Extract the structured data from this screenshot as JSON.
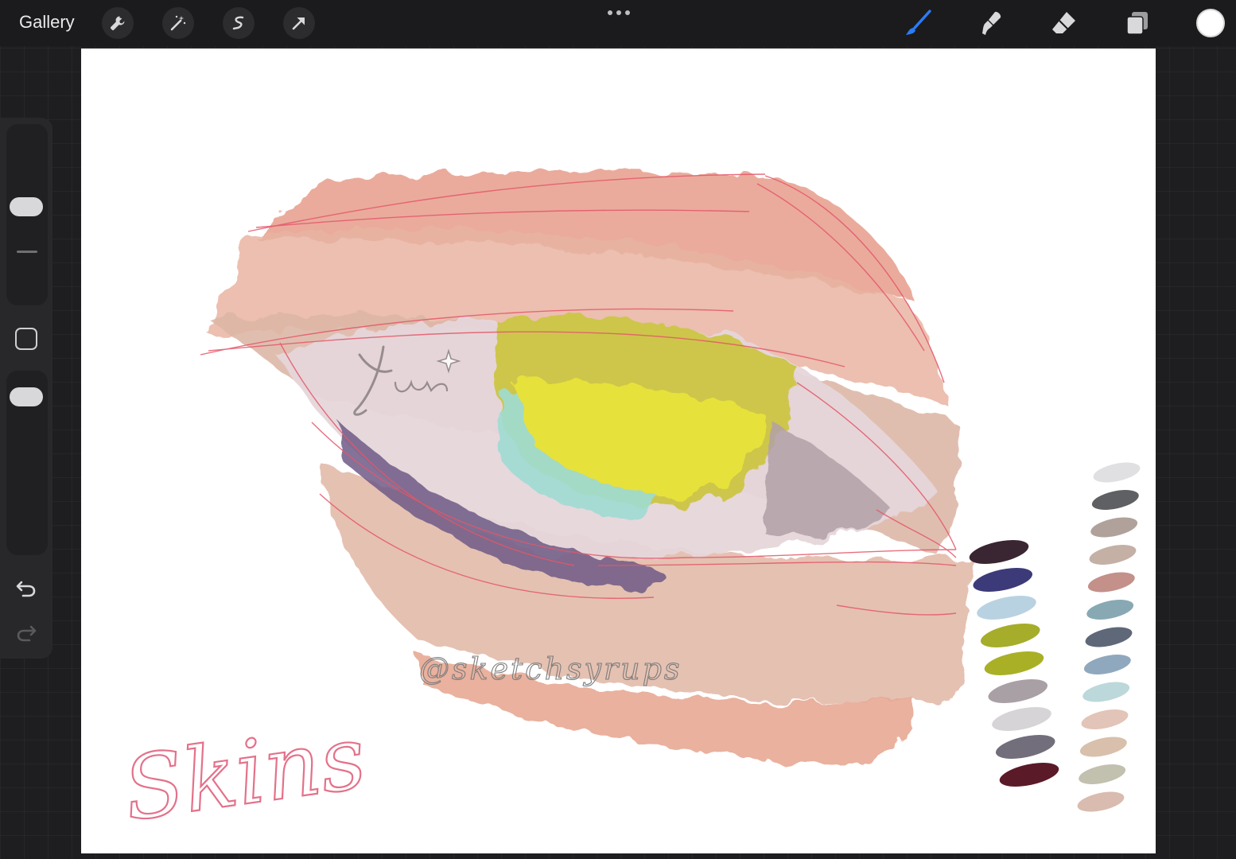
{
  "topbar": {
    "gallery_label": "Gallery",
    "left_tools": [
      {
        "name": "wrench-icon"
      },
      {
        "name": "magic-wand-icon"
      },
      {
        "name": "selection-icon"
      },
      {
        "name": "transform-arrow-icon"
      }
    ],
    "right_tools": [
      {
        "name": "brush-icon",
        "active_color": "#2a7cf6"
      },
      {
        "name": "smudge-icon"
      },
      {
        "name": "eraser-icon"
      },
      {
        "name": "layers-icon"
      }
    ],
    "current_color": "#ffffff"
  },
  "sidebar": {
    "brush_size_level": 0.55,
    "opacity_level": 0.9,
    "undo_icon": "undo-arrow-icon",
    "redo_icon": "redo-arrow-icon"
  },
  "canvas": {
    "watermark_signature": "Yuva",
    "watermark_handle": "@sketchsyrups",
    "handwritten_label": "Skins",
    "palette_left": [
      "#3a2532",
      "#3c3a78",
      "#b9d2e2",
      "#a5ad2a",
      "#a9b026",
      "#a9a0a5",
      "#d6d4d7",
      "#736e7b",
      "#5a1a27"
    ],
    "palette_right": [
      "#e0e0e2",
      "#5f6063",
      "#b0a29b",
      "#c5b0a6",
      "#c4908a",
      "#88a9b3",
      "#5e6878",
      "#90a8bd",
      "#bcd8da",
      "#e2c4b8",
      "#d8c0ac",
      "#c2c0ae",
      "#d9bcaf"
    ]
  }
}
